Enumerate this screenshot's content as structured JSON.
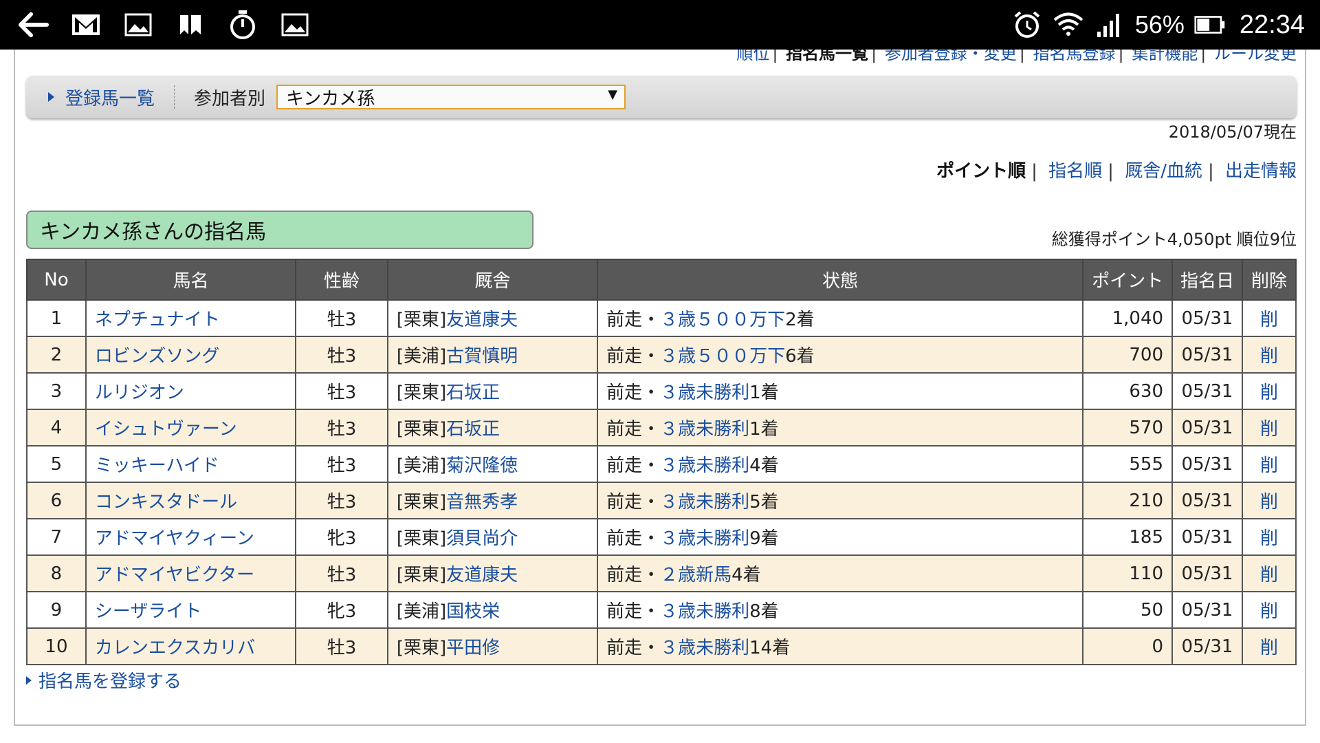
{
  "status_bar": {
    "battery_percent": "56%",
    "clock": "22:34",
    "left_icons": [
      "back-arrow-icon",
      "gmail-icon",
      "image-icon",
      "bookmarks-icon",
      "stopwatch-icon",
      "image-icon"
    ],
    "right_icons": [
      "alarm-icon",
      "wifi-icon",
      "signal-icon",
      "battery-icon"
    ]
  },
  "top_nav": {
    "items": [
      {
        "label": "順位",
        "current": false
      },
      {
        "label": "指名馬一覧",
        "current": true
      },
      {
        "label": "参加者登録・変更",
        "current": false
      },
      {
        "label": "指名馬登録",
        "current": false
      },
      {
        "label": "集計機能",
        "current": false
      },
      {
        "label": "ルール変更",
        "current": false
      }
    ]
  },
  "filter": {
    "all_horses_link": "登録馬一覧",
    "by_participant_label": "参加者別",
    "selected_participant": "キンカメ孫"
  },
  "as_of": "2018/05/07現在",
  "sort_links": {
    "current": "ポイント順",
    "others": [
      "指名順",
      "厩舎/血統",
      "出走情報"
    ]
  },
  "section_title": "キンカメ孫さんの指名馬",
  "summary": "総獲得ポイント4,050pt 順位9位",
  "table": {
    "headers": {
      "no": "No",
      "name": "馬名",
      "sex_age": "性齢",
      "stable": "厩舎",
      "state": "状態",
      "points": "ポイント",
      "date": "指名日",
      "delete": "削除"
    },
    "rows": [
      {
        "no": "1",
        "name": "ネプチュナイト",
        "sex_age": "牡3",
        "center": "[栗東]",
        "trainer": "友道康夫",
        "prefix": "前走・",
        "race": "３歳５００万下",
        "result": "2着",
        "points": "1,040",
        "date": "05/31",
        "delete": "削"
      },
      {
        "no": "2",
        "name": "ロビンズソング",
        "sex_age": "牡3",
        "center": "[美浦]",
        "trainer": "古賀慎明",
        "prefix": "前走・",
        "race": "３歳５００万下",
        "result": "6着",
        "points": "700",
        "date": "05/31",
        "delete": "削"
      },
      {
        "no": "3",
        "name": "ルリジオン",
        "sex_age": "牡3",
        "center": "[栗東]",
        "trainer": "石坂正",
        "prefix": "前走・",
        "race": "３歳未勝利",
        "result": "1着",
        "points": "630",
        "date": "05/31",
        "delete": "削"
      },
      {
        "no": "4",
        "name": "イシュトヴァーン",
        "sex_age": "牡3",
        "center": "[栗東]",
        "trainer": "石坂正",
        "prefix": "前走・",
        "race": "３歳未勝利",
        "result": "1着",
        "points": "570",
        "date": "05/31",
        "delete": "削"
      },
      {
        "no": "5",
        "name": "ミッキーハイド",
        "sex_age": "牡3",
        "center": "[美浦]",
        "trainer": "菊沢隆徳",
        "prefix": "前走・",
        "race": "３歳未勝利",
        "result": "4着",
        "points": "555",
        "date": "05/31",
        "delete": "削"
      },
      {
        "no": "6",
        "name": "コンキスタドール",
        "sex_age": "牡3",
        "center": "[栗東]",
        "trainer": "音無秀孝",
        "prefix": "前走・",
        "race": "３歳未勝利",
        "result": "5着",
        "points": "210",
        "date": "05/31",
        "delete": "削"
      },
      {
        "no": "7",
        "name": "アドマイヤクィーン",
        "sex_age": "牝3",
        "center": "[栗東]",
        "trainer": "須貝尚介",
        "prefix": "前走・",
        "race": "３歳未勝利",
        "result": "9着",
        "points": "185",
        "date": "05/31",
        "delete": "削"
      },
      {
        "no": "8",
        "name": "アドマイヤビクター",
        "sex_age": "牡3",
        "center": "[栗東]",
        "trainer": "友道康夫",
        "prefix": "前走・",
        "race": "２歳新馬",
        "result": "4着",
        "points": "110",
        "date": "05/31",
        "delete": "削"
      },
      {
        "no": "9",
        "name": "シーザライト",
        "sex_age": "牝3",
        "center": "[美浦]",
        "trainer": "国枝栄",
        "prefix": "前走・",
        "race": "３歳未勝利",
        "result": "8着",
        "points": "50",
        "date": "05/31",
        "delete": "削"
      },
      {
        "no": "10",
        "name": "カレンエクスカリバ",
        "sex_age": "牡3",
        "center": "[栗東]",
        "trainer": "平田修",
        "prefix": "前走・",
        "race": "３歳未勝利",
        "result": "14着",
        "points": "0",
        "date": "05/31",
        "delete": "削"
      }
    ]
  },
  "register_link": "指名馬を登録する",
  "colors": {
    "link": "#1a4fa0",
    "header_bg": "#585858",
    "row_alt": "#fbf0dc",
    "title_box": "#a8e0b8",
    "select_border": "#e2a227"
  }
}
